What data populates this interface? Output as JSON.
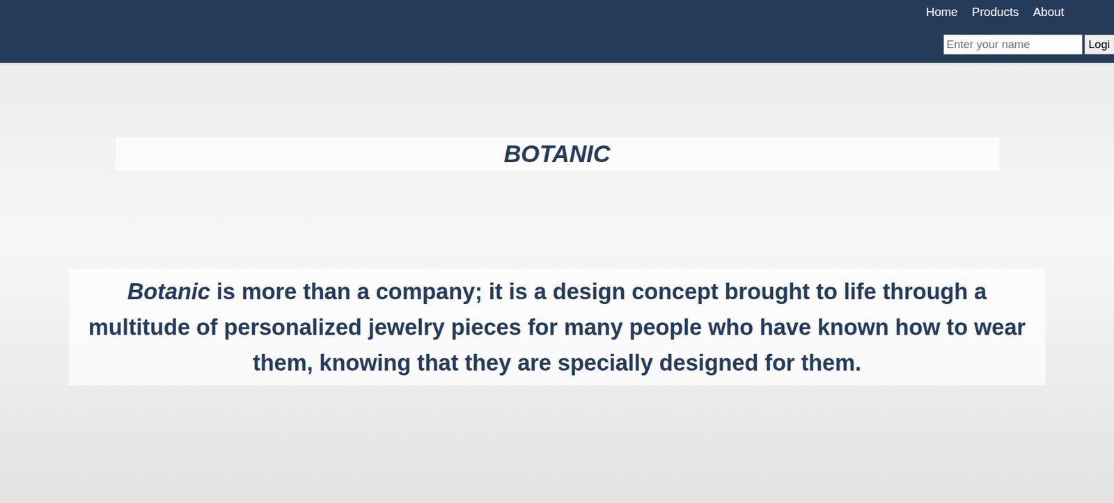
{
  "nav": {
    "links": [
      "Home",
      "Products",
      "About"
    ]
  },
  "login": {
    "placeholder": "Enter your name",
    "button": "Logi"
  },
  "hero": {
    "title": "BOTANIC",
    "paragraph": {
      "emphasis": "Botanic",
      "text": " is more than a company; it is a design concept brought to life through a multitude of personalized jewelry pieces for many people who have known how to wear them, knowing that they are specially designed for them."
    }
  }
}
